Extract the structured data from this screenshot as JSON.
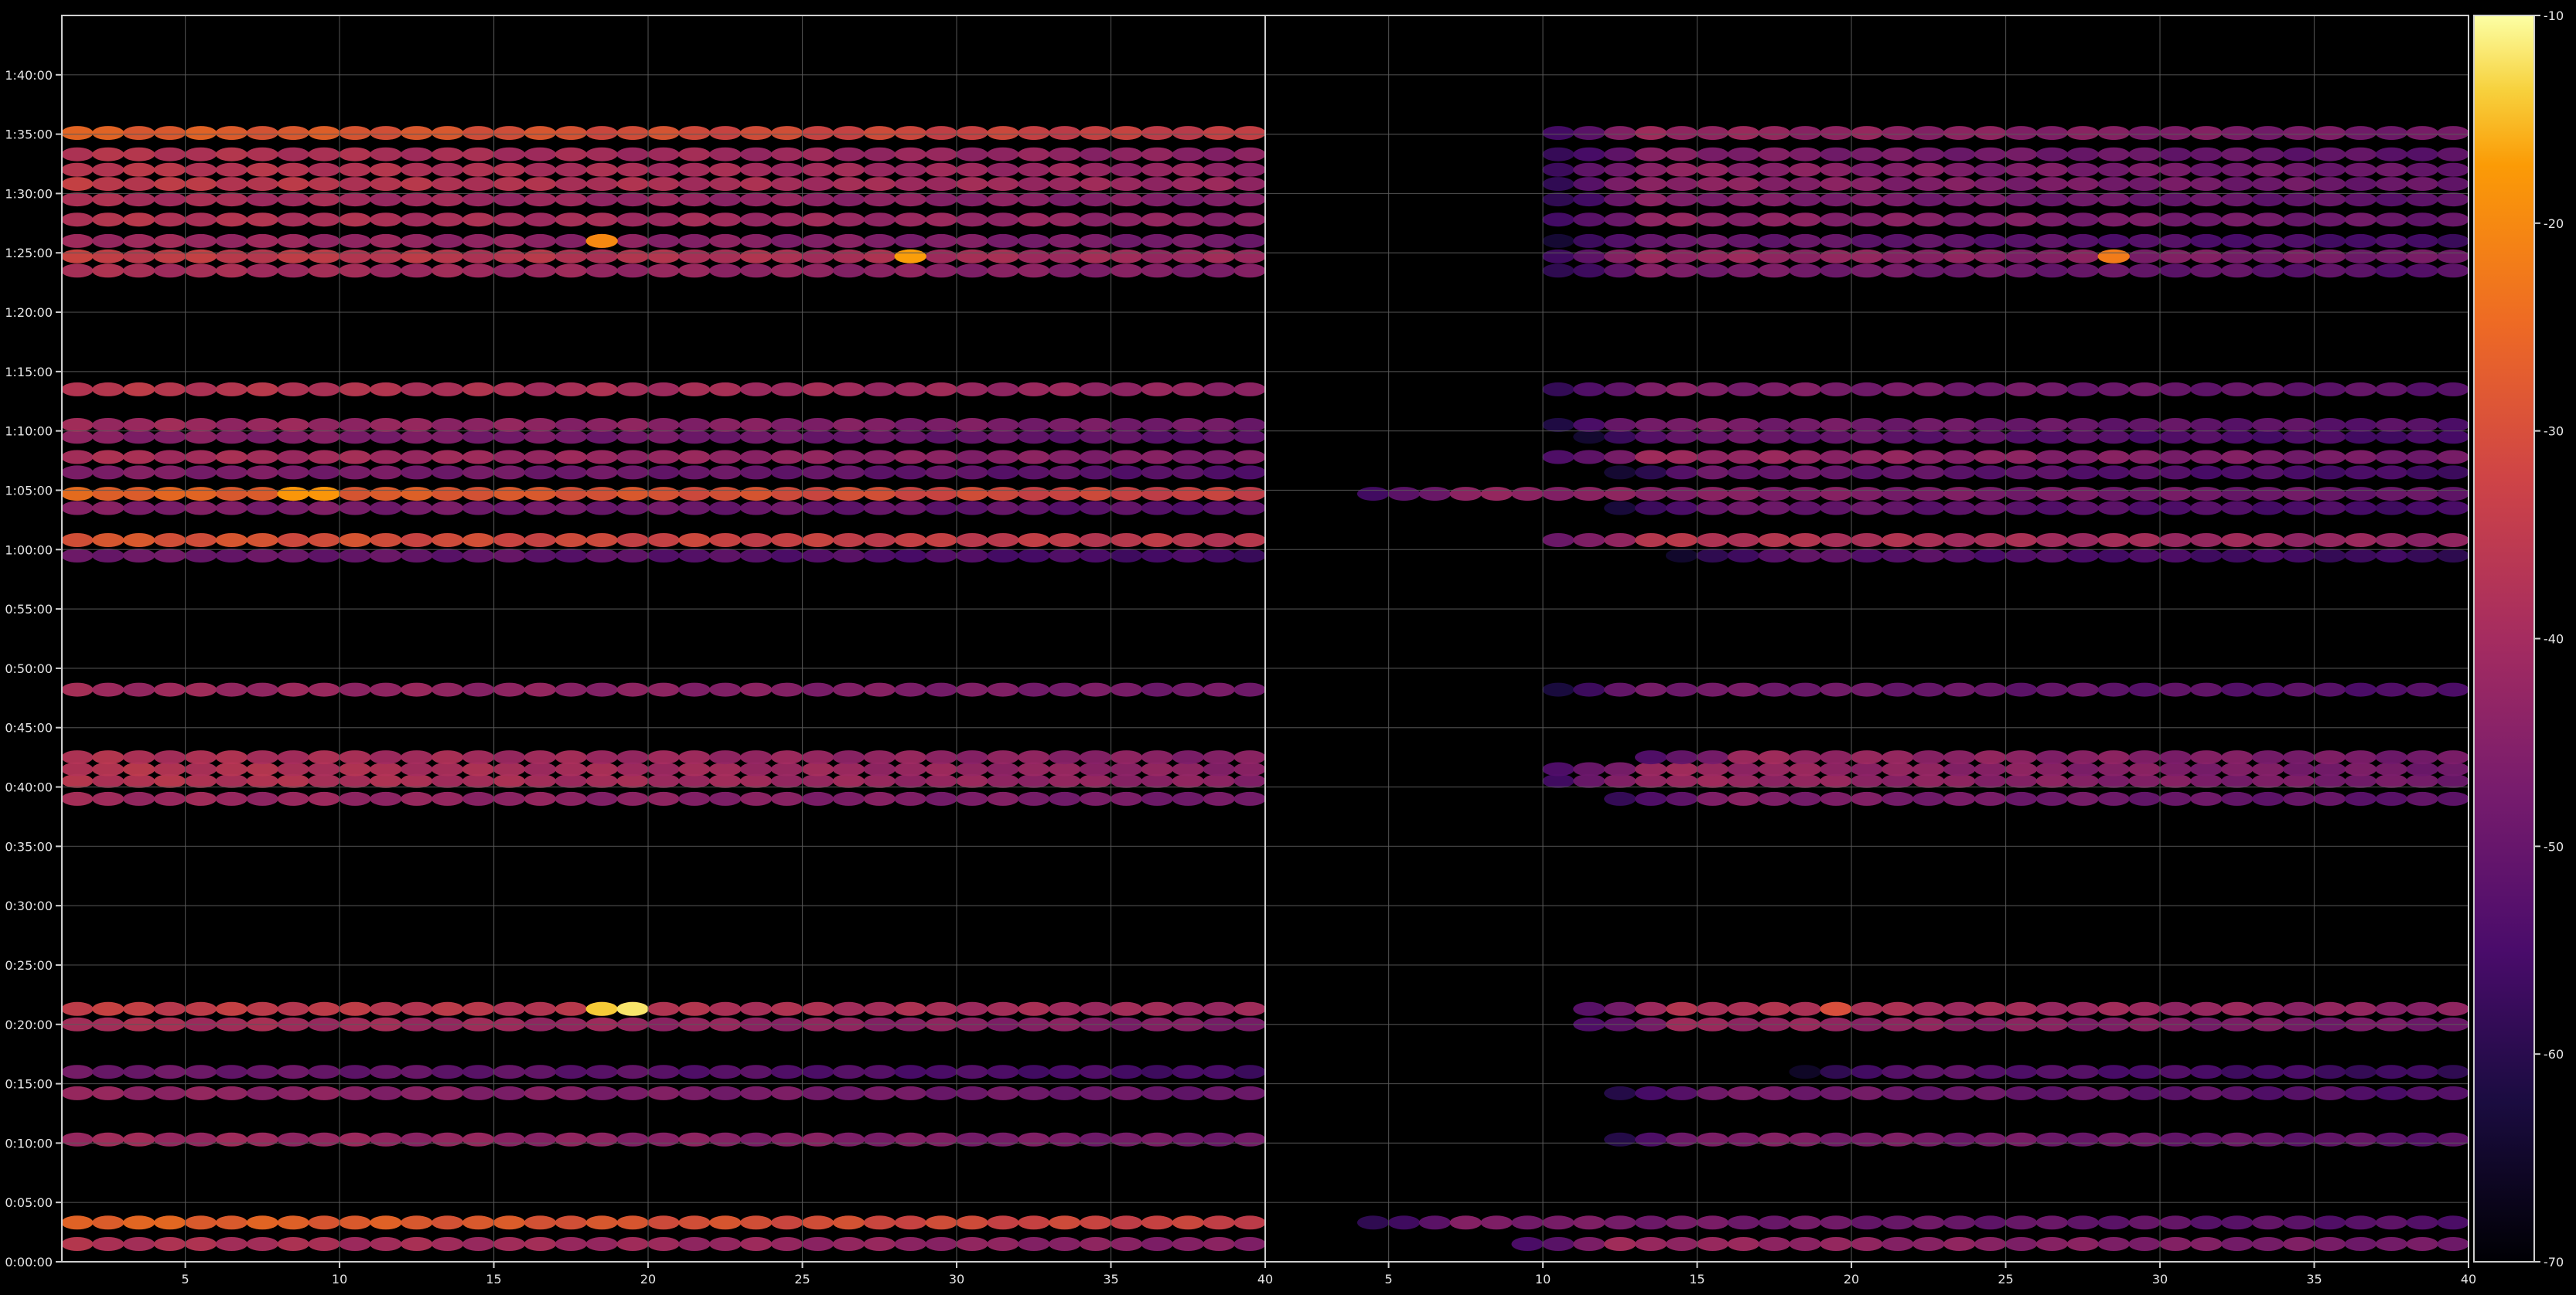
{
  "colors": {
    "background": "#000000",
    "axis": "#cfcfcf",
    "grid": "#5a5a5a",
    "text": "#e6e6e6"
  },
  "chart_data": {
    "type": "heatmap",
    "colormap": "inferno",
    "grid": true,
    "y_ticks": [
      "0:00:00",
      "0:05:00",
      "0:10:00",
      "0:15:00",
      "0:20:00",
      "0:25:00",
      "0:30:00",
      "0:35:00",
      "0:40:00",
      "0:45:00",
      "0:50:00",
      "0:55:00",
      "1:00:00",
      "1:05:00",
      "1:10:00",
      "1:15:00",
      "1:20:00",
      "1:25:00",
      "1:30:00",
      "1:35:00",
      "1:40:00"
    ],
    "y_range_minutes": [
      0,
      105
    ],
    "colorbar": {
      "range": [
        -70,
        -10
      ],
      "ticks": [
        "-10",
        "-20",
        "-30",
        "-40",
        "-50",
        "-60",
        "-70"
      ],
      "tick_values": [
        -10,
        -20,
        -30,
        -40,
        -50,
        -60,
        -70
      ]
    },
    "panels": [
      {
        "x_range": [
          1,
          40
        ],
        "x_ticks": [
          "5",
          "10",
          "15",
          "20",
          "25",
          "30",
          "35",
          "40"
        ],
        "x_tick_values": [
          5,
          10,
          15,
          20,
          25,
          30,
          35,
          40
        ],
        "bands": [
          {
            "time_min": 1.5,
            "level": -37,
            "start_col": 1,
            "fade_end": 40
          },
          {
            "time_min": 3.3,
            "level": -25,
            "start_col": 1,
            "fade_end": 40
          },
          {
            "time_min": 10.3,
            "level": -40,
            "start_col": 1,
            "fade_end": 40
          },
          {
            "time_min": 14.2,
            "level": -42,
            "start_col": 1,
            "fade_end": 40
          },
          {
            "time_min": 16.0,
            "level": -48,
            "start_col": 1,
            "fade_end": 40
          },
          {
            "time_min": 20.0,
            "level": -38,
            "start_col": 1,
            "fade_end": 40
          },
          {
            "time_min": 21.3,
            "level": -33,
            "start_col": 1,
            "fade_end": 40
          },
          {
            "time_min": 39.0,
            "level": -40,
            "start_col": 1,
            "fade_end": 40
          },
          {
            "time_min": 40.5,
            "level": -36,
            "start_col": 1,
            "fade_end": 40
          },
          {
            "time_min": 41.5,
            "level": -36,
            "start_col": 1,
            "fade_end": 40
          },
          {
            "time_min": 42.5,
            "level": -37,
            "start_col": 1,
            "fade_end": 40
          },
          {
            "time_min": 48.2,
            "level": -40,
            "start_col": 1,
            "fade_end": 40
          },
          {
            "time_min": 59.5,
            "level": -48,
            "start_col": 1,
            "fade_end": 40
          },
          {
            "time_min": 60.8,
            "level": -28,
            "start_col": 1,
            "fade_end": 40
          },
          {
            "time_min": 63.5,
            "level": -45,
            "start_col": 1,
            "fade_end": 40
          },
          {
            "time_min": 64.7,
            "level": -25,
            "start_col": 1,
            "fade_end": 40
          },
          {
            "time_min": 66.5,
            "level": -45,
            "start_col": 1,
            "fade_end": 40
          },
          {
            "time_min": 67.8,
            "level": -38,
            "start_col": 1,
            "fade_end": 40
          },
          {
            "time_min": 69.5,
            "level": -44,
            "start_col": 1,
            "fade_end": 40
          },
          {
            "time_min": 70.5,
            "level": -40,
            "start_col": 1,
            "fade_end": 40
          },
          {
            "time_min": 73.5,
            "level": -35,
            "start_col": 1,
            "fade_end": 40
          },
          {
            "time_min": 83.5,
            "level": -38,
            "start_col": 1,
            "fade_end": 40
          },
          {
            "time_min": 84.7,
            "level": -33,
            "start_col": 1,
            "fade_end": 40
          },
          {
            "time_min": 86.0,
            "level": -40,
            "start_col": 1,
            "fade_end": 40
          },
          {
            "time_min": 87.8,
            "level": -36,
            "start_col": 1,
            "fade_end": 40
          },
          {
            "time_min": 89.5,
            "level": -38,
            "start_col": 1,
            "fade_end": 40
          },
          {
            "time_min": 90.8,
            "level": -34,
            "start_col": 1,
            "fade_end": 40
          },
          {
            "time_min": 92.0,
            "level": -35,
            "start_col": 1,
            "fade_end": 40
          },
          {
            "time_min": 93.3,
            "level": -36,
            "start_col": 1,
            "fade_end": 40
          },
          {
            "time_min": 95.1,
            "level": -26,
            "start_col": 1,
            "fade_end": 40
          }
        ]
      },
      {
        "x_range": [
          1,
          40
        ],
        "x_ticks": [
          "5",
          "10",
          "15",
          "20",
          "25",
          "30",
          "35",
          "40"
        ],
        "x_tick_values": [
          5,
          10,
          15,
          20,
          25,
          30,
          35,
          40
        ],
        "bands": [
          {
            "time_min": 1.5,
            "level": -40,
            "start_col": 9,
            "fade_end": 40
          },
          {
            "time_min": 3.3,
            "level": -45,
            "start_col": 4,
            "fade_end": 40
          },
          {
            "time_min": 10.3,
            "level": -44,
            "start_col": 12,
            "fade_end": 40
          },
          {
            "time_min": 14.2,
            "level": -46,
            "start_col": 12,
            "fade_end": 40
          },
          {
            "time_min": 16.0,
            "level": -50,
            "start_col": 18,
            "fade_end": 40
          },
          {
            "time_min": 20.0,
            "level": -40,
            "start_col": 11,
            "fade_end": 40
          },
          {
            "time_min": 21.3,
            "level": -36,
            "start_col": 11,
            "fade_end": 40
          },
          {
            "time_min": 39.0,
            "level": -44,
            "start_col": 12,
            "fade_end": 40
          },
          {
            "time_min": 40.5,
            "level": -40,
            "start_col": 10,
            "fade_end": 40
          },
          {
            "time_min": 41.5,
            "level": -40,
            "start_col": 10,
            "fade_end": 40
          },
          {
            "time_min": 42.5,
            "level": -40,
            "start_col": 13,
            "fade_end": 40
          },
          {
            "time_min": 48.2,
            "level": -46,
            "start_col": 10,
            "fade_end": 40
          },
          {
            "time_min": 59.5,
            "level": -50,
            "start_col": 14,
            "fade_end": 40
          },
          {
            "time_min": 60.8,
            "level": -35,
            "start_col": 10,
            "fade_end": 40
          },
          {
            "time_min": 63.5,
            "level": -48,
            "start_col": 12,
            "fade_end": 40
          },
          {
            "time_min": 64.7,
            "level": -42,
            "start_col": 4,
            "fade_end": 40
          },
          {
            "time_min": 66.5,
            "level": -48,
            "start_col": 12,
            "fade_end": 40
          },
          {
            "time_min": 67.8,
            "level": -40,
            "start_col": 10,
            "fade_end": 40
          },
          {
            "time_min": 69.5,
            "level": -48,
            "start_col": 11,
            "fade_end": 40
          },
          {
            "time_min": 70.5,
            "level": -45,
            "start_col": 10,
            "fade_end": 40
          },
          {
            "time_min": 73.5,
            "level": -44,
            "start_col": 10,
            "fade_end": 40
          },
          {
            "time_min": 83.5,
            "level": -45,
            "start_col": 10,
            "fade_end": 40
          },
          {
            "time_min": 84.7,
            "level": -40,
            "start_col": 10,
            "fade_end": 40
          },
          {
            "time_min": 86.0,
            "level": -48,
            "start_col": 10,
            "fade_end": 40
          },
          {
            "time_min": 87.8,
            "level": -42,
            "start_col": 10,
            "fade_end": 40
          },
          {
            "time_min": 89.5,
            "level": -44,
            "start_col": 10,
            "fade_end": 40
          },
          {
            "time_min": 90.8,
            "level": -42,
            "start_col": 10,
            "fade_end": 40
          },
          {
            "time_min": 92.0,
            "level": -42,
            "start_col": 10,
            "fade_end": 40
          },
          {
            "time_min": 93.3,
            "level": -44,
            "start_col": 10,
            "fade_end": 40
          },
          {
            "time_min": 95.1,
            "level": -40,
            "start_col": 10,
            "fade_end": 40
          }
        ]
      }
    ],
    "hotspots": [
      {
        "panel": 0,
        "time_min": 21.3,
        "col": 18,
        "level": -14
      },
      {
        "panel": 0,
        "time_min": 21.3,
        "col": 19,
        "level": -12
      },
      {
        "panel": 0,
        "time_min": 64.7,
        "col": 8,
        "level": -18
      },
      {
        "panel": 0,
        "time_min": 64.7,
        "col": 9,
        "level": -18
      },
      {
        "panel": 0,
        "time_min": 86.0,
        "col": 18,
        "level": -20
      },
      {
        "panel": 0,
        "time_min": 84.7,
        "col": 28,
        "level": -17
      },
      {
        "panel": 1,
        "time_min": 84.7,
        "col": 28,
        "level": -22
      },
      {
        "panel": 1,
        "time_min": 21.3,
        "col": 19,
        "level": -30
      }
    ]
  }
}
